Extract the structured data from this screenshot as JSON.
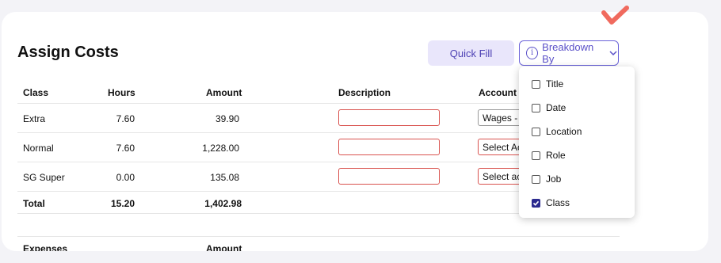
{
  "page": {
    "title": "Assign Costs"
  },
  "toolbar": {
    "quick_fill_label": "Quick Fill",
    "breakdown_label": "Breakdown By"
  },
  "table": {
    "headers": [
      "Class",
      "Hours",
      "Amount",
      "Description",
      "Account"
    ],
    "rows": [
      {
        "class": "Extra",
        "hours": "7.60",
        "amount": "39.90",
        "description": "",
        "account": "Wages - 2"
      },
      {
        "class": "Normal",
        "hours": "7.60",
        "amount": "1,228.00",
        "description": "",
        "account": "Select Ac"
      },
      {
        "class": "SG Super",
        "hours": "0.00",
        "amount": "135.08",
        "description": "",
        "account": "Select ac"
      }
    ],
    "total": {
      "label": "Total",
      "hours": "15.20",
      "amount": "1,402.98"
    }
  },
  "expenses": {
    "headers": [
      "Expenses",
      "Amount"
    ]
  },
  "dropdown": {
    "options": [
      {
        "label": "Title",
        "checked": false
      },
      {
        "label": "Date",
        "checked": false
      },
      {
        "label": "Location",
        "checked": false
      },
      {
        "label": "Role",
        "checked": false
      },
      {
        "label": "Job",
        "checked": false
      },
      {
        "label": "Class",
        "checked": true
      }
    ]
  },
  "colors": {
    "accent": "#5a50c8",
    "error_border": "#d9534f",
    "checkmark": "#f06a5e"
  }
}
